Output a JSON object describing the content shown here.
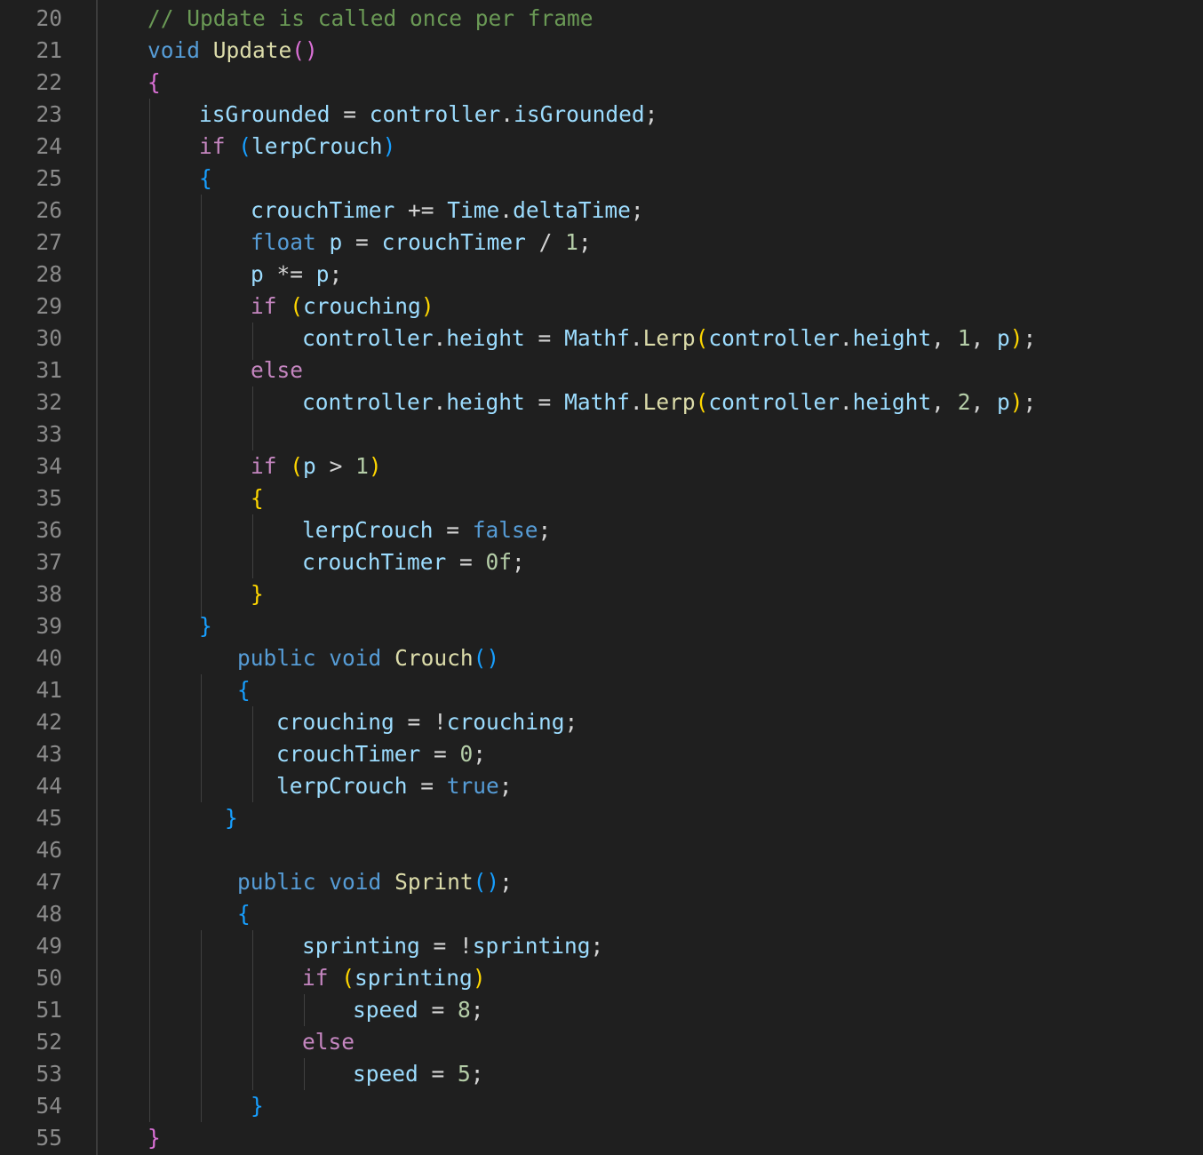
{
  "editor": {
    "colors": {
      "background": "#1f1f1f",
      "line_number": "#8a8a8a",
      "comment": "#6a9955",
      "keyword_control": "#c586c0",
      "keyword": "#569cd6",
      "function": "#dcdcaa",
      "variable": "#9cdcfe",
      "number": "#b5cea8",
      "plain": "#d4d4d4",
      "bracket_pink": "#da70d6",
      "bracket_blue": "#179fff",
      "bracket_gold": "#ffd700"
    },
    "lines": [
      {
        "n": "20",
        "indent": 166,
        "tokens": [
          {
            "t": "// Update is called once per frame",
            "c": "comment"
          }
        ]
      },
      {
        "n": "21",
        "indent": 166,
        "tokens": [
          {
            "t": "void",
            "c": "keyword"
          },
          {
            "t": " ",
            "c": "plain"
          },
          {
            "t": "Update",
            "c": "function"
          },
          {
            "t": "()",
            "c": "bracket_pink"
          }
        ]
      },
      {
        "n": "22",
        "indent": 166,
        "tokens": [
          {
            "t": "{",
            "c": "bracket_pink"
          }
        ]
      },
      {
        "n": "23",
        "indent": 224,
        "tokens": [
          {
            "t": "isGrounded",
            "c": "variable"
          },
          {
            "t": " = ",
            "c": "plain"
          },
          {
            "t": "controller",
            "c": "variable"
          },
          {
            "t": ".",
            "c": "plain"
          },
          {
            "t": "isGrounded",
            "c": "variable"
          },
          {
            "t": ";",
            "c": "plain"
          }
        ]
      },
      {
        "n": "24",
        "indent": 224,
        "tokens": [
          {
            "t": "if",
            "c": "keyword_control"
          },
          {
            "t": " ",
            "c": "plain"
          },
          {
            "t": "(",
            "c": "bracket_blue"
          },
          {
            "t": "lerpCrouch",
            "c": "variable"
          },
          {
            "t": ")",
            "c": "bracket_blue"
          }
        ]
      },
      {
        "n": "25",
        "indent": 224,
        "tokens": [
          {
            "t": "{",
            "c": "bracket_blue"
          }
        ]
      },
      {
        "n": "26",
        "indent": 282,
        "tokens": [
          {
            "t": "crouchTimer",
            "c": "variable"
          },
          {
            "t": " += ",
            "c": "plain"
          },
          {
            "t": "Time",
            "c": "variable"
          },
          {
            "t": ".",
            "c": "plain"
          },
          {
            "t": "deltaTime",
            "c": "variable"
          },
          {
            "t": ";",
            "c": "plain"
          }
        ]
      },
      {
        "n": "27",
        "indent": 282,
        "tokens": [
          {
            "t": "float",
            "c": "keyword"
          },
          {
            "t": " ",
            "c": "plain"
          },
          {
            "t": "p",
            "c": "variable"
          },
          {
            "t": " = ",
            "c": "plain"
          },
          {
            "t": "crouchTimer",
            "c": "variable"
          },
          {
            "t": " / ",
            "c": "plain"
          },
          {
            "t": "1",
            "c": "number"
          },
          {
            "t": ";",
            "c": "plain"
          }
        ]
      },
      {
        "n": "28",
        "indent": 282,
        "tokens": [
          {
            "t": "p",
            "c": "variable"
          },
          {
            "t": " *= ",
            "c": "plain"
          },
          {
            "t": "p",
            "c": "variable"
          },
          {
            "t": ";",
            "c": "plain"
          }
        ]
      },
      {
        "n": "29",
        "indent": 282,
        "tokens": [
          {
            "t": "if",
            "c": "keyword_control"
          },
          {
            "t": " ",
            "c": "plain"
          },
          {
            "t": "(",
            "c": "bracket_gold"
          },
          {
            "t": "crouching",
            "c": "variable"
          },
          {
            "t": ")",
            "c": "bracket_gold"
          }
        ]
      },
      {
        "n": "30",
        "indent": 340,
        "tokens": [
          {
            "t": "controller",
            "c": "variable"
          },
          {
            "t": ".",
            "c": "plain"
          },
          {
            "t": "height",
            "c": "variable"
          },
          {
            "t": " = ",
            "c": "plain"
          },
          {
            "t": "Mathf",
            "c": "variable"
          },
          {
            "t": ".",
            "c": "plain"
          },
          {
            "t": "Lerp",
            "c": "function"
          },
          {
            "t": "(",
            "c": "bracket_gold"
          },
          {
            "t": "controller",
            "c": "variable"
          },
          {
            "t": ".",
            "c": "plain"
          },
          {
            "t": "height",
            "c": "variable"
          },
          {
            "t": ", ",
            "c": "plain"
          },
          {
            "t": "1",
            "c": "number"
          },
          {
            "t": ", ",
            "c": "plain"
          },
          {
            "t": "p",
            "c": "variable"
          },
          {
            "t": ")",
            "c": "bracket_gold"
          },
          {
            "t": ";",
            "c": "plain"
          }
        ]
      },
      {
        "n": "31",
        "indent": 282,
        "tokens": [
          {
            "t": "else",
            "c": "keyword_control"
          }
        ]
      },
      {
        "n": "32",
        "indent": 340,
        "tokens": [
          {
            "t": "controller",
            "c": "variable"
          },
          {
            "t": ".",
            "c": "plain"
          },
          {
            "t": "height",
            "c": "variable"
          },
          {
            "t": " = ",
            "c": "plain"
          },
          {
            "t": "Mathf",
            "c": "variable"
          },
          {
            "t": ".",
            "c": "plain"
          },
          {
            "t": "Lerp",
            "c": "function"
          },
          {
            "t": "(",
            "c": "bracket_gold"
          },
          {
            "t": "controller",
            "c": "variable"
          },
          {
            "t": ".",
            "c": "plain"
          },
          {
            "t": "height",
            "c": "variable"
          },
          {
            "t": ", ",
            "c": "plain"
          },
          {
            "t": "2",
            "c": "number"
          },
          {
            "t": ", ",
            "c": "plain"
          },
          {
            "t": "p",
            "c": "variable"
          },
          {
            "t": ")",
            "c": "bracket_gold"
          },
          {
            "t": ";",
            "c": "plain"
          }
        ]
      },
      {
        "n": "33",
        "indent": 282,
        "tokens": []
      },
      {
        "n": "34",
        "indent": 282,
        "tokens": [
          {
            "t": "if",
            "c": "keyword_control"
          },
          {
            "t": " ",
            "c": "plain"
          },
          {
            "t": "(",
            "c": "bracket_gold"
          },
          {
            "t": "p",
            "c": "variable"
          },
          {
            "t": " > ",
            "c": "plain"
          },
          {
            "t": "1",
            "c": "number"
          },
          {
            "t": ")",
            "c": "bracket_gold"
          }
        ]
      },
      {
        "n": "35",
        "indent": 282,
        "tokens": [
          {
            "t": "{",
            "c": "bracket_gold"
          }
        ]
      },
      {
        "n": "36",
        "indent": 340,
        "tokens": [
          {
            "t": "lerpCrouch",
            "c": "variable"
          },
          {
            "t": " = ",
            "c": "plain"
          },
          {
            "t": "false",
            "c": "keyword"
          },
          {
            "t": ";",
            "c": "plain"
          }
        ]
      },
      {
        "n": "37",
        "indent": 340,
        "tokens": [
          {
            "t": "crouchTimer",
            "c": "variable"
          },
          {
            "t": " = ",
            "c": "plain"
          },
          {
            "t": "0f",
            "c": "number"
          },
          {
            "t": ";",
            "c": "plain"
          }
        ]
      },
      {
        "n": "38",
        "indent": 282,
        "tokens": [
          {
            "t": "}",
            "c": "bracket_gold"
          }
        ]
      },
      {
        "n": "39",
        "indent": 224,
        "tokens": [
          {
            "t": "}",
            "c": "bracket_blue"
          }
        ]
      },
      {
        "n": "40",
        "indent": 267,
        "tokens": [
          {
            "t": "public",
            "c": "keyword"
          },
          {
            "t": " ",
            "c": "plain"
          },
          {
            "t": "void",
            "c": "keyword"
          },
          {
            "t": " ",
            "c": "plain"
          },
          {
            "t": "Crouch",
            "c": "function"
          },
          {
            "t": "()",
            "c": "bracket_blue"
          }
        ]
      },
      {
        "n": "41",
        "indent": 267,
        "tokens": [
          {
            "t": "{",
            "c": "bracket_blue"
          }
        ]
      },
      {
        "n": "42",
        "indent": 311,
        "tokens": [
          {
            "t": "crouching",
            "c": "variable"
          },
          {
            "t": " = !",
            "c": "plain"
          },
          {
            "t": "crouching",
            "c": "variable"
          },
          {
            "t": ";",
            "c": "plain"
          }
        ]
      },
      {
        "n": "43",
        "indent": 311,
        "tokens": [
          {
            "t": "crouchTimer",
            "c": "variable"
          },
          {
            "t": " = ",
            "c": "plain"
          },
          {
            "t": "0",
            "c": "number"
          },
          {
            "t": ";",
            "c": "plain"
          }
        ]
      },
      {
        "n": "44",
        "indent": 311,
        "tokens": [
          {
            "t": "lerpCrouch",
            "c": "variable"
          },
          {
            "t": " = ",
            "c": "plain"
          },
          {
            "t": "true",
            "c": "keyword"
          },
          {
            "t": ";",
            "c": "plain"
          }
        ]
      },
      {
        "n": "45",
        "indent": 253,
        "tokens": [
          {
            "t": "}",
            "c": "bracket_blue"
          }
        ]
      },
      {
        "n": "46",
        "indent": 253,
        "tokens": []
      },
      {
        "n": "47",
        "indent": 267,
        "tokens": [
          {
            "t": "public",
            "c": "keyword"
          },
          {
            "t": " ",
            "c": "plain"
          },
          {
            "t": "void",
            "c": "keyword"
          },
          {
            "t": " ",
            "c": "plain"
          },
          {
            "t": "Sprint",
            "c": "function"
          },
          {
            "t": "()",
            "c": "bracket_blue"
          },
          {
            "t": ";",
            "c": "plain"
          }
        ]
      },
      {
        "n": "48",
        "indent": 267,
        "tokens": [
          {
            "t": "{",
            "c": "bracket_blue"
          }
        ]
      },
      {
        "n": "49",
        "indent": 340,
        "tokens": [
          {
            "t": "sprinting",
            "c": "variable"
          },
          {
            "t": " = !",
            "c": "plain"
          },
          {
            "t": "sprinting",
            "c": "variable"
          },
          {
            "t": ";",
            "c": "plain"
          }
        ]
      },
      {
        "n": "50",
        "indent": 340,
        "tokens": [
          {
            "t": "if",
            "c": "keyword_control"
          },
          {
            "t": " ",
            "c": "plain"
          },
          {
            "t": "(",
            "c": "bracket_gold"
          },
          {
            "t": "sprinting",
            "c": "variable"
          },
          {
            "t": ")",
            "c": "bracket_gold"
          }
        ]
      },
      {
        "n": "51",
        "indent": 397,
        "tokens": [
          {
            "t": "speed",
            "c": "variable"
          },
          {
            "t": " = ",
            "c": "plain"
          },
          {
            "t": "8",
            "c": "number"
          },
          {
            "t": ";",
            "c": "plain"
          }
        ]
      },
      {
        "n": "52",
        "indent": 340,
        "tokens": [
          {
            "t": "else",
            "c": "keyword_control"
          }
        ]
      },
      {
        "n": "53",
        "indent": 397,
        "tokens": [
          {
            "t": "speed",
            "c": "variable"
          },
          {
            "t": " = ",
            "c": "plain"
          },
          {
            "t": "5",
            "c": "number"
          },
          {
            "t": ";",
            "c": "plain"
          }
        ]
      },
      {
        "n": "54",
        "indent": 282,
        "tokens": [
          {
            "t": "}",
            "c": "bracket_blue"
          }
        ]
      },
      {
        "n": "55",
        "indent": 166,
        "tokens": [
          {
            "t": "}",
            "c": "bracket_pink"
          }
        ]
      }
    ]
  }
}
